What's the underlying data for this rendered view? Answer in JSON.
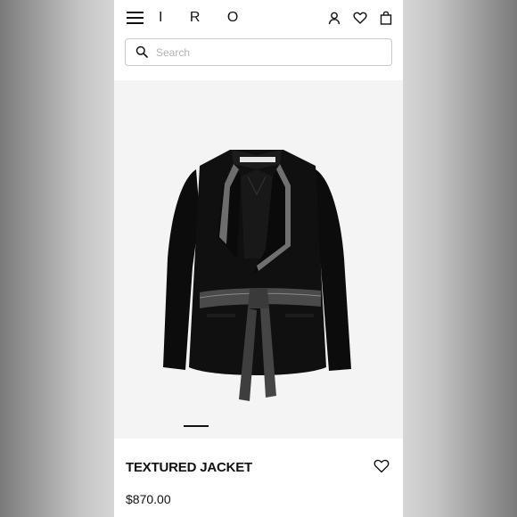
{
  "header": {
    "brand": "I R O",
    "icons": [
      "menu-icon",
      "account-icon",
      "heart-icon",
      "bag-icon"
    ]
  },
  "search": {
    "placeholder": "Search",
    "value": ""
  },
  "gallery": {
    "image": "black textured jacket with leather-trimmed lapels and tie belt",
    "active_slide": 1
  },
  "product": {
    "title": "TEXTURED JACKET",
    "price": "$870.00"
  },
  "colors": {
    "text": "#111111",
    "image_background": "#f4f4f4",
    "search_border": "#c8c8c8"
  }
}
